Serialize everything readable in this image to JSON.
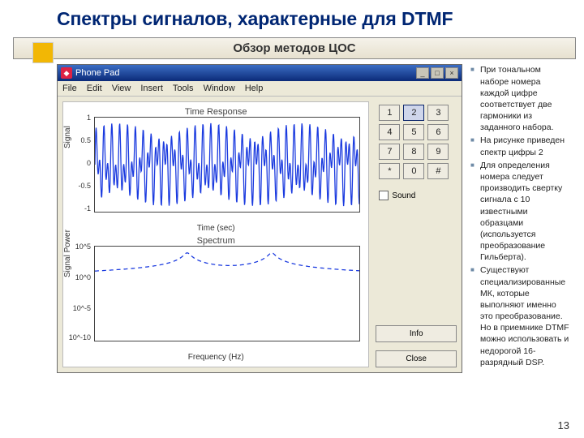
{
  "title": "Спектры сигналов, характерные для DTMF",
  "subtitle": "Обзор методов ЦОС",
  "page": "13",
  "app": {
    "title": "Phone Pad",
    "menu": [
      "File",
      "Edit",
      "View",
      "Insert",
      "Tools",
      "Window",
      "Help"
    ],
    "winbtns": [
      "_",
      "□",
      "×"
    ]
  },
  "sidepanel": {
    "keys": [
      "1",
      "2",
      "3",
      "4",
      "5",
      "6",
      "7",
      "8",
      "9",
      "*",
      "0",
      "#"
    ],
    "active": "2",
    "sound": "Sound",
    "info": "Info",
    "close": "Close"
  },
  "notes": [
    "При тональном наборе номера каждой цифре соответствует две гармоники из заданного набора.",
    "На рисунке приведен спектр цифры 2",
    "Для определения номера следует производить свертку сигнала с 10 известными образцами (используется преобразование Гильберта).",
    "Существуют специализированные МК, которые выполняют именно это преобразование. Но в приемнике DTMF можно использовать и недорогой 16-разрядный DSP."
  ],
  "chart_data": [
    {
      "type": "line",
      "title": "Time Response",
      "xlabel": "Time (sec)",
      "ylabel": "Signal",
      "xlim": [
        0,
        0.05
      ],
      "ylim": [
        -1,
        1
      ],
      "xticks": [
        0,
        0.01,
        0.02,
        0.03,
        0.04,
        0.05
      ],
      "yticks": [
        -1,
        -0.5,
        0,
        0.5,
        1
      ],
      "note": "Sum of two tones (DTMF digit 2 ≈ 697 Hz + 1336 Hz), oscillatory waveform with beating envelope"
    },
    {
      "type": "line",
      "title": "Spectrum",
      "xlabel": "Frequency (Hz)",
      "ylabel": "Signal Power",
      "xlim": [
        0,
        2000
      ],
      "ylim_log10": [
        -10,
        5
      ],
      "xticks": [
        0,
        500,
        1000,
        1500,
        2000
      ],
      "yticks_exp": [
        "10^5",
        "10^0",
        "10^-5",
        "10^-10"
      ],
      "peaks_hz": [
        697,
        1336
      ],
      "note": "Two spectral peaks near 697 Hz and 1336 Hz (log power scale)"
    }
  ]
}
